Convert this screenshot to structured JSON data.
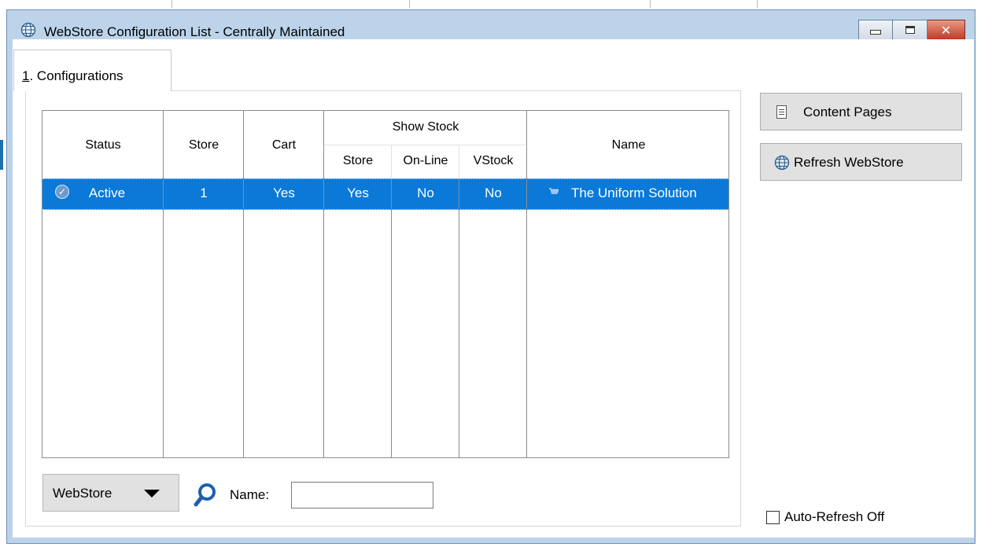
{
  "window": {
    "title": "WebStore Configuration List - Centrally Maintained"
  },
  "tabs": [
    {
      "mnemonic": "1",
      "rest": ". Configurations"
    }
  ],
  "grid": {
    "headers": {
      "status": "Status",
      "store": "Store",
      "cart": "Cart",
      "show_stock": "Show Stock",
      "show_stock_store": "Store",
      "show_stock_online": "On-Line",
      "show_stock_vstock": "VStock",
      "name": "Name"
    },
    "rows": [
      {
        "status": "Active",
        "store": "1",
        "cart": "Yes",
        "show_store": "Yes",
        "show_online": "No",
        "show_vstock": "No",
        "name": "The Uniform Solution",
        "selected": true
      }
    ]
  },
  "side_buttons": {
    "content_pages": "Content Pages",
    "refresh_webstore": "Refresh WebStore"
  },
  "footer": {
    "dropdown_value": "WebStore",
    "name_label": "Name:",
    "name_value": "",
    "auto_refresh_label": "Auto-Refresh Off",
    "auto_refresh_checked": false
  },
  "colors": {
    "selection": "#0b79d8",
    "window_frame": "#bcd3ea",
    "close_button": "#c23a25"
  },
  "icons": [
    "globe-icon",
    "minimize-icon",
    "maximize-icon",
    "close-icon",
    "check-circle-icon",
    "cart-icon",
    "document-icon",
    "search-icon",
    "chevron-down-icon"
  ]
}
